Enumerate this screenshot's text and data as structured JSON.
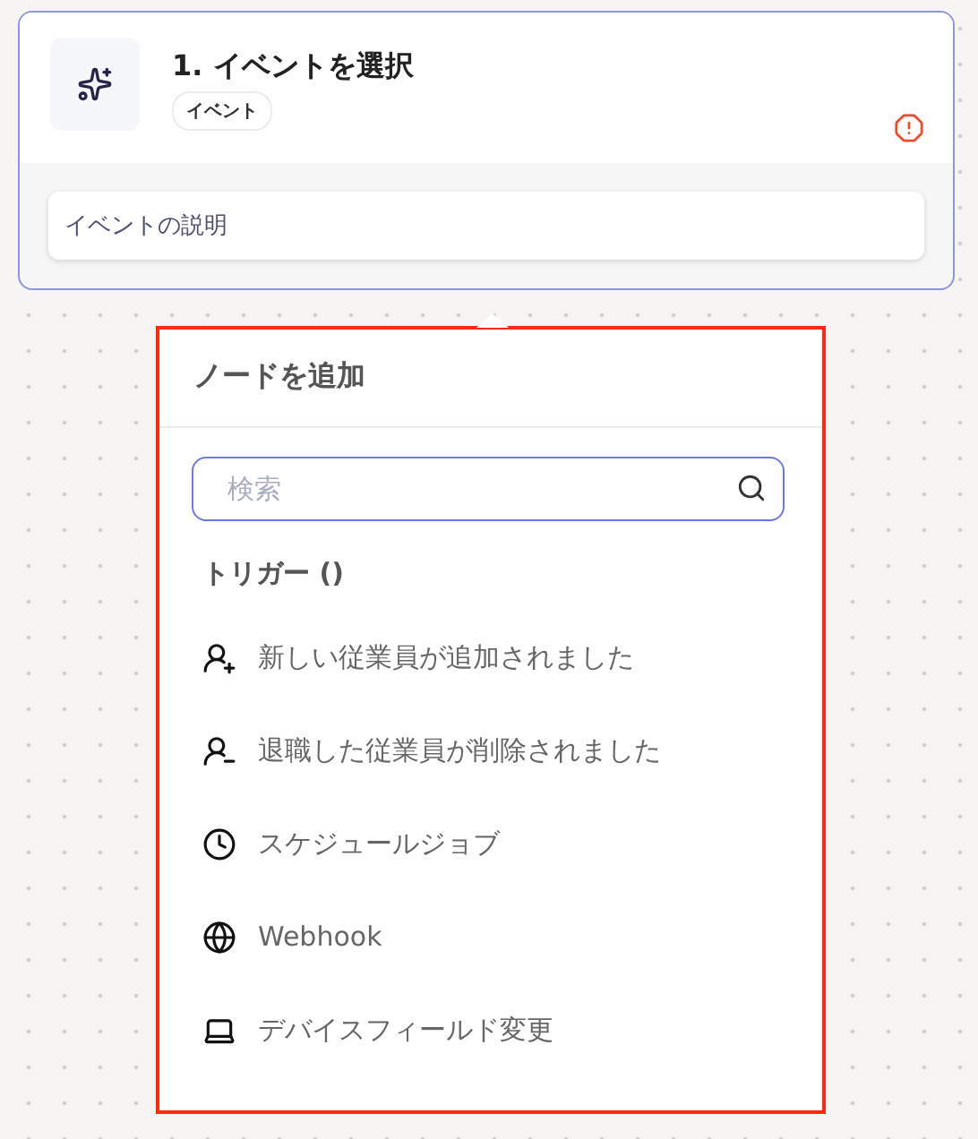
{
  "node": {
    "title": "1. イベントを選択",
    "badge": "イベント",
    "description": "イベントの説明",
    "has_error": true
  },
  "popup": {
    "title": "ノードを追加",
    "search": {
      "placeholder": "検索"
    },
    "section": "トリガー ()",
    "items": [
      {
        "kind": "hire",
        "label": "新しい従業員が追加されました"
      },
      {
        "kind": "leave",
        "label": "退職した従業員が削除されました"
      },
      {
        "kind": "schedule",
        "label": "スケジュールジョブ"
      },
      {
        "kind": "webhook",
        "label": "Webhook"
      },
      {
        "kind": "device",
        "label": "デバイスフィールド変更"
      }
    ]
  }
}
